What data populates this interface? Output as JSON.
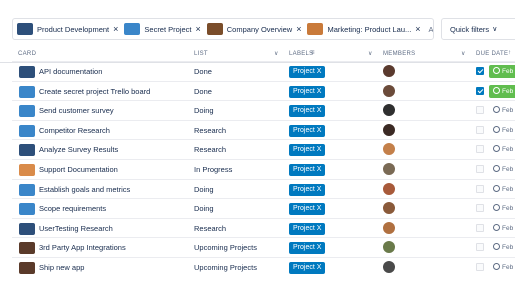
{
  "toolbar": {
    "tabs": [
      {
        "label": "Product Development",
        "thumb": "#2d4f7a"
      },
      {
        "label": "Secret Project",
        "thumb": "#3a86c9"
      },
      {
        "label": "Company Overview",
        "thumb": "#7a4d2a"
      },
      {
        "label": "Marketing: Product Lau...",
        "thumb": "#c97a3a"
      }
    ],
    "close_icon": "×",
    "add_boards_label": "Add Boards",
    "quick_filters_label": "Quick filters"
  },
  "columns": {
    "card": "CARD",
    "list": "LIST",
    "labels": "LABELS",
    "members": "MEMBERS",
    "due_date": "DUE DATE"
  },
  "rows": [
    {
      "card": "API documentation",
      "list": "Done",
      "label": "Project X",
      "thumb": "#2d4f7a",
      "avatar": "#5a3a2e",
      "checked": true,
      "due": "Feb",
      "due_green": true
    },
    {
      "card": "Create secret project Trello board",
      "list": "Done",
      "label": "Project X",
      "thumb": "#3a86c9",
      "avatar": "#6b4b3a",
      "checked": true,
      "due": "Feb",
      "due_green": true
    },
    {
      "card": "Send customer survey",
      "list": "Doing",
      "label": "Project X",
      "thumb": "#3a86c9",
      "avatar": "#2f2f2f",
      "checked": false,
      "due": "Feb",
      "due_green": false
    },
    {
      "card": "Competitor Research",
      "list": "Research",
      "label": "Project X",
      "thumb": "#3a86c9",
      "avatar": "#3b2a24",
      "checked": false,
      "due": "Feb",
      "due_green": false
    },
    {
      "card": "Analyze Survey Results",
      "list": "Research",
      "label": "Project X",
      "thumb": "#2d4f7a",
      "avatar": "#c4804a",
      "checked": false,
      "due": "Feb",
      "due_green": false
    },
    {
      "card": "Support Documentation",
      "list": "In Progress",
      "label": "Project X",
      "thumb": "#d98b4a",
      "avatar": "#7a6a55",
      "checked": false,
      "due": "Feb",
      "due_green": false
    },
    {
      "card": "Establish goals and metrics",
      "list": "Doing",
      "label": "Project X",
      "thumb": "#3a86c9",
      "avatar": "#a85a3a",
      "checked": false,
      "due": "Feb",
      "due_green": false
    },
    {
      "card": "Scope requirements",
      "list": "Doing",
      "label": "Project X",
      "thumb": "#3a86c9",
      "avatar": "#8a5a3a",
      "checked": false,
      "due": "Feb",
      "due_green": false
    },
    {
      "card": "UserTesting Research",
      "list": "Research",
      "label": "Project X",
      "thumb": "#2d4f7a",
      "avatar": "#b07040",
      "checked": false,
      "due": "Feb",
      "due_green": false
    },
    {
      "card": "3rd Party App Integrations",
      "list": "Upcoming Projects",
      "label": "Project X",
      "thumb": "#5a3a2a",
      "avatar": "#6a7a4a",
      "checked": false,
      "due": "Feb",
      "due_green": false
    },
    {
      "card": "Ship new app",
      "list": "Upcoming Projects",
      "label": "Project X",
      "thumb": "#5a3a2a",
      "avatar": "#4a4a4a",
      "checked": false,
      "due": "Feb",
      "due_green": false
    }
  ]
}
